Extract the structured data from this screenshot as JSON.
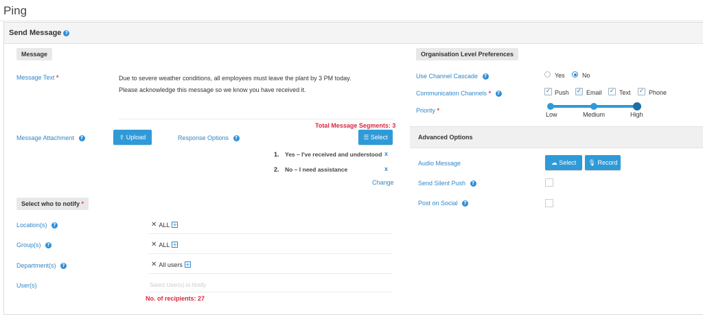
{
  "app_title": "Ping",
  "panel": {
    "title": "Send Message"
  },
  "message_section": {
    "header": "Message",
    "message_text_label": "Message Text",
    "message_text": "Due to severe weather conditions, all employees must leave the plant by 3 PM today. Please acknowledge this message so we know you have received it.",
    "segments": "Total Message Segments: 3",
    "attachment_label": "Message Attachment",
    "upload_label": "Upload",
    "response_options_label": "Response Options",
    "select_label": "Select",
    "responses": [
      {
        "num": "1.",
        "text": "Yes – I've received and understood",
        "remove": "x"
      },
      {
        "num": "2.",
        "text": "No – I need assistance",
        "remove": "x"
      }
    ],
    "change_label": "Change"
  },
  "notify_section": {
    "header": "Select who to notify",
    "location_label": "Location(s)",
    "location_value": "ALL",
    "group_label": "Group(s)",
    "group_value": "ALL",
    "department_label": "Department(s)",
    "department_value": "All users",
    "user_label": "User(s)",
    "user_placeholder": "Select User(s) to Notify",
    "recipients": "No. of recipients: 27"
  },
  "org_prefs": {
    "header": "Organisation Level Preferences",
    "cascade_label": "Use Channel Cascade",
    "cascade_yes": "Yes",
    "cascade_no": "No",
    "cascade_value": "No",
    "channels_label": "Communication Channels",
    "channels": [
      {
        "label": "Push",
        "checked": true
      },
      {
        "label": "Email",
        "checked": true
      },
      {
        "label": "Text",
        "checked": true
      },
      {
        "label": "Phone",
        "checked": true
      }
    ],
    "priority_label": "Priority",
    "priority_levels": [
      "Low",
      "Medium",
      "High"
    ],
    "priority_value": "High"
  },
  "advanced": {
    "header": "Advanced Options",
    "audio_label": "Audio Message",
    "audio_select": "Select",
    "audio_record": "Record",
    "silent_push_label": "Send Silent Push",
    "social_label": "Post on Social"
  },
  "icons": {
    "help": "help-circle-icon",
    "upload": "upload-icon",
    "list": "list-icon",
    "cloud_upload": "cloud-upload-icon",
    "microphone": "microphone-icon",
    "remove_tag": "x-icon",
    "add": "plus-box-icon",
    "check": "checkmark-icon"
  },
  "colors": {
    "accent": "#2f9ad8",
    "link": "#2f86c8",
    "required": "#e23b3b",
    "alert": "#d9263c"
  }
}
